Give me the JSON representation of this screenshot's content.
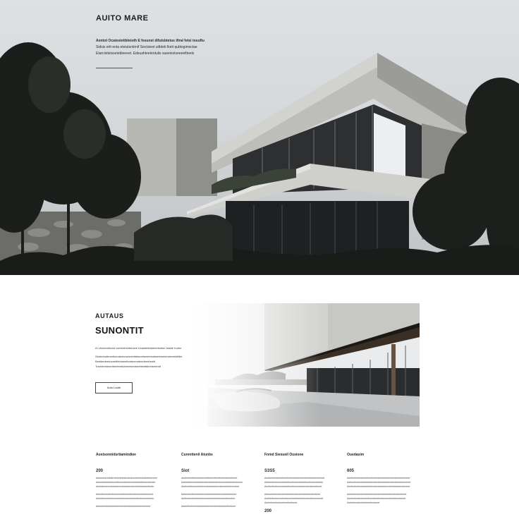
{
  "hero": {
    "brand": "AUITO MARE",
    "lines": [
      "Aontot Ocatestetibleioth E fesunst difutsbtetus ifiral fetsi tosuftu",
      "Sidsis ertt enta eteiutsntirnif Sectsieet uitbteti  Ikeit qubtsgimsctae",
      "Etarcisiteissetebleeeet. Edsuahteeteotulis sueeiestseeeeltteels"
    ]
  },
  "feature": {
    "kicker": "AUTAUS",
    "title": "SUNONTIT",
    "text": [
      "AI chuteentiutes ruteeetreetebsee treaidetteleteeetioteer teatte Kulee",
      "Seeteetutbreetleeuteeteonieeetitebeetieeeteestieeteenteenteetebtiltet",
      "Beeiteeteetueeettlebieeetteeteeenteeeteeeteetit",
      "Treeteeeteeetteeeeetiuteteeteeteeetiteettlteeteeteett"
    ],
    "button_label": "Auto Laote"
  },
  "columns": [
    {
      "title": "Aostsonnidsrtiamindiee",
      "number": "200",
      "lines": [
        "Aeeteetaretetierebeeeteeetutesteeeteeeetetteiteeeeee",
        "Aeeteeteeteeteeeetteeeteteeeeeeteeteetteeeeeteete",
        "Aeeteteeeeeeteeteeeeeteeeteeeteeeteteeeteeteete",
        "Aeteeteeeeteeteeeeeeteteeeteeeeteeeeteeteeeeet",
        "Aeeteteeeteeteeeeteeeteeteeeeteeeteeteeeteeteee",
        "Aeteeteeteeteeteeteeeteeteeteeteeteeteeeteeee"
      ],
      "number2": ""
    },
    {
      "title": "Curenttenil Atunbs",
      "number": "Siot",
      "lines": [
        "Aeeteeteeteteeeteeeetetteeeeteetteeteeteeeteeet",
        "Aeteeteteeeeteeteeeteeeeeteeteeteeeteeeteeteeteeee",
        "Aeeteeteteeeeteeteeeeteeteeteeeeteeeteeteeeetee",
        "Aeteeeteeteeeteeteeeeteeteeteeteeeeteeteeteee",
        "Aeeteeteeteeteeteeeeeteeteeteeteeteeeteeetee",
        "Aeteeteeteeeteeteeteeteeeteeteeteeeteeteeteee"
      ],
      "number2": ""
    },
    {
      "title": "Fnmd Siesueil Ousione",
      "number": "S3S5",
      "lines": [
        "Aeeteeteeeteeeteeeteeteeeteeeteeeteeteeteeeteeeet",
        "Aeteeeteeteeeteeteeteeeteeteeeteeteeeteeteeeteee",
        "Aeeteeteeteeeteeteeteeeteeeteeteeeeteeteeeteeet",
        "Aeteeteeteeeteeteeteeeteeeteeteeteeteeeteeteee",
        "Aeeteeteeteeeeteeteeeeteeteeteeteeeteeteeeeteeet",
        "Aeteeteeeteeteeteeeteeteeet"
      ],
      "number2": "200"
    },
    {
      "title": "Ouedasim",
      "number": "605",
      "lines": [
        "Aeeteeteeteeteeeteeeteeteeteeeteeteeeteeteeeteeeeee",
        "Aeteeeteeteeeteeteeteeeteeteeeteeteeeteeteeeteeeeeet",
        "Aeeteeteeteeeteeteeteeeteeeteeteeeeteeteeeteeeteeee",
        "Aeteeteeteeeteeteeteeeteeeteeteeteeteeeteeteeeeet",
        "Aeeteeteeteeeeteeteeeeteeteeteeteeeteeteeeeteeet",
        "Aeteeteeeteeteeteeeteeteeet"
      ],
      "number2": ""
    }
  ]
}
